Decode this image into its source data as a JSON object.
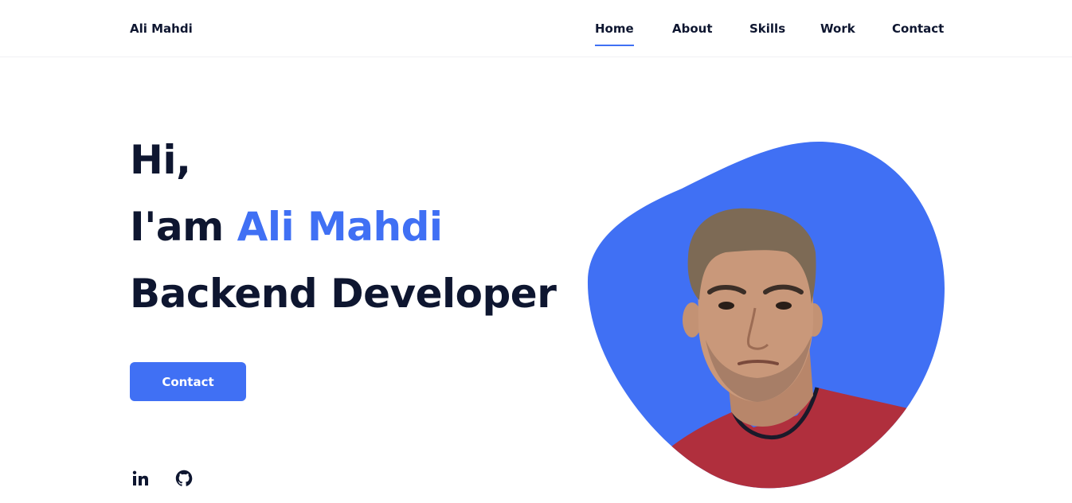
{
  "header": {
    "logo": "Ali Mahdi",
    "nav": [
      {
        "label": "Home",
        "active": true
      },
      {
        "label": "About",
        "active": false
      },
      {
        "label": "Skills",
        "active": false
      },
      {
        "label": "Work",
        "active": false
      },
      {
        "label": "Contact",
        "active": false
      }
    ]
  },
  "hero": {
    "greeting": "Hi,",
    "intro_prefix": "I'am ",
    "name": "Ali Mahdi",
    "role": "Backend Developer",
    "cta_label": "Contact"
  },
  "social": [
    {
      "name": "linkedin",
      "icon": "linkedin-icon"
    },
    {
      "name": "github",
      "icon": "github-icon"
    }
  ],
  "colors": {
    "accent": "#4070f4",
    "text": "#0e1630",
    "shirt": "#b02f3d"
  }
}
